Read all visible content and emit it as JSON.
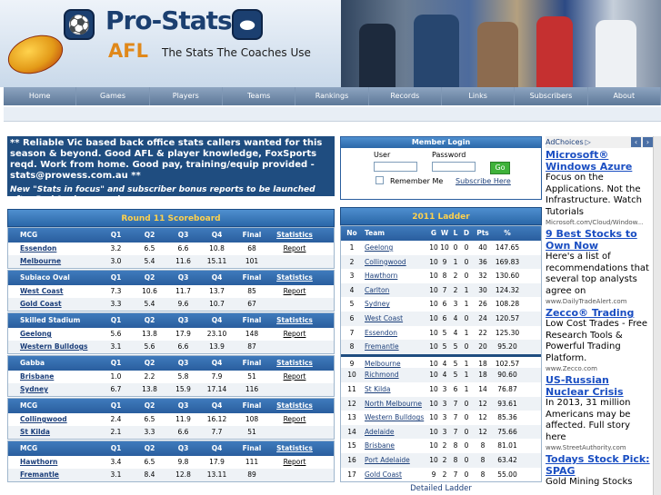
{
  "header": {
    "logo_title": "Pro-Stats",
    "logo_sub": "AFL",
    "tagline": "The Stats The Coaches Use"
  },
  "nav": [
    "Home",
    "Games",
    "Players",
    "Teams",
    "Rankings",
    "Records",
    "Links",
    "Subscribers",
    "About"
  ],
  "news": {
    "main": "** Reliable Vic based back office stats callers wanted for this season & beyond. Good AFL & player knowledge, FoxSports reqd. Work from home. Good pay, training/equip provided - stats@prowess.com.au **",
    "second": "New \"Stats in focus\" and subscriber bonus reports to be launched after Rnd 9, view samples..."
  },
  "scoreboard": {
    "title": "Round 11 Scoreboard",
    "cols": [
      "Q1",
      "Q2",
      "Q3",
      "Q4",
      "Final",
      "Statistics"
    ],
    "games": [
      {
        "venue": "MCG",
        "rows": [
          {
            "team": "Essendon",
            "q": [
              "3.2",
              "6.5",
              "6.6",
              "10.8"
            ],
            "final": "68",
            "link": "Report"
          },
          {
            "team": "Melbourne",
            "q": [
              "3.0",
              "5.4",
              "11.6",
              "15.11"
            ],
            "final": "101",
            "link": ""
          }
        ]
      },
      {
        "venue": "Subiaco Oval",
        "rows": [
          {
            "team": "West Coast",
            "q": [
              "7.3",
              "10.6",
              "11.7",
              "13.7"
            ],
            "final": "85",
            "link": "Report"
          },
          {
            "team": "Gold Coast",
            "q": [
              "3.3",
              "5.4",
              "9.6",
              "10.7"
            ],
            "final": "67",
            "link": ""
          }
        ]
      },
      {
        "venue": "Skilled Stadium",
        "rows": [
          {
            "team": "Geelong",
            "q": [
              "5.6",
              "13.8",
              "17.9",
              "23.10"
            ],
            "final": "148",
            "link": "Report"
          },
          {
            "team": "Western Bulldogs",
            "q": [
              "3.1",
              "5.6",
              "6.6",
              "13.9"
            ],
            "final": "87",
            "link": ""
          }
        ]
      },
      {
        "venue": "Gabba",
        "rows": [
          {
            "team": "Brisbane",
            "q": [
              "1.0",
              "2.2",
              "5.8",
              "7.9"
            ],
            "final": "51",
            "link": "Report"
          },
          {
            "team": "Sydney",
            "q": [
              "6.7",
              "13.8",
              "15.9",
              "17.14"
            ],
            "final": "116",
            "link": ""
          }
        ]
      },
      {
        "venue": "MCG",
        "rows": [
          {
            "team": "Collingwood",
            "q": [
              "2.4",
              "6.5",
              "11.9",
              "16.12"
            ],
            "final": "108",
            "link": "Report"
          },
          {
            "team": "St Kilda",
            "q": [
              "2.1",
              "3.3",
              "6.6",
              "7.7"
            ],
            "final": "51",
            "link": ""
          }
        ]
      },
      {
        "venue": "MCG",
        "rows": [
          {
            "team": "Hawthorn",
            "q": [
              "3.4",
              "6.5",
              "9.8",
              "17.9"
            ],
            "final": "111",
            "link": "Report"
          },
          {
            "team": "Fremantle",
            "q": [
              "3.1",
              "8.4",
              "12.8",
              "13.11"
            ],
            "final": "89",
            "link": ""
          }
        ]
      }
    ]
  },
  "member": {
    "title": "Member Login",
    "user_label": "User",
    "password_label": "Password",
    "go_label": "Go",
    "remember_label": "Remember Me",
    "subscribe_label": "Subscribe Here"
  },
  "ladder": {
    "title": "2011 Ladder",
    "cols": [
      "No",
      "Team",
      "G",
      "W",
      "L",
      "D",
      "Pts",
      "%"
    ],
    "rows": [
      [
        "1",
        "Geelong",
        "10",
        "10",
        "0",
        "0",
        "40",
        "147.65"
      ],
      [
        "2",
        "Collingwood",
        "10",
        "9",
        "1",
        "0",
        "36",
        "169.83"
      ],
      [
        "3",
        "Hawthorn",
        "10",
        "8",
        "2",
        "0",
        "32",
        "130.60"
      ],
      [
        "4",
        "Carlton",
        "10",
        "7",
        "2",
        "1",
        "30",
        "124.32"
      ],
      [
        "5",
        "Sydney",
        "10",
        "6",
        "3",
        "1",
        "26",
        "108.28"
      ],
      [
        "6",
        "West Coast",
        "10",
        "6",
        "4",
        "0",
        "24",
        "120.57"
      ],
      [
        "7",
        "Essendon",
        "10",
        "5",
        "4",
        "1",
        "22",
        "125.30"
      ],
      [
        "8",
        "Fremantle",
        "10",
        "5",
        "5",
        "0",
        "20",
        "95.20"
      ],
      [
        "9",
        "Melbourne",
        "10",
        "4",
        "5",
        "1",
        "18",
        "102.57"
      ],
      [
        "10",
        "Richmond",
        "10",
        "4",
        "5",
        "1",
        "18",
        "90.60"
      ],
      [
        "11",
        "St Kilda",
        "10",
        "3",
        "6",
        "1",
        "14",
        "76.87"
      ],
      [
        "12",
        "North Melbourne",
        "10",
        "3",
        "7",
        "0",
        "12",
        "93.61"
      ],
      [
        "13",
        "Western Bulldogs",
        "10",
        "3",
        "7",
        "0",
        "12",
        "85.36"
      ],
      [
        "14",
        "Adelaide",
        "10",
        "3",
        "7",
        "0",
        "12",
        "75.66"
      ],
      [
        "15",
        "Brisbane",
        "10",
        "2",
        "8",
        "0",
        "8",
        "81.01"
      ],
      [
        "16",
        "Port Adelaide",
        "10",
        "2",
        "8",
        "0",
        "8",
        "63.42"
      ],
      [
        "17",
        "Gold Coast",
        "9",
        "2",
        "7",
        "0",
        "8",
        "55.00"
      ]
    ],
    "detailed_label": "Detailed Ladder"
  },
  "ads": {
    "adchoices": "AdChoices",
    "items": [
      {
        "title": "Microsoft® Windows Azure",
        "body": "Focus on the Applications. Not the Infrastructure. Watch Tutorials",
        "url": "Microsoft.com/Cloud/Window..."
      },
      {
        "title": "9 Best Stocks to Own Now",
        "body": "Here's a list of recommendations that several top analysts agree on",
        "url": "www.DailyTradeAlert.com"
      },
      {
        "title": "Zecco® Trading",
        "body": "Low Cost Trades - Free Research Tools & Powerful Trading Platform.",
        "url": "www.Zecco.com"
      },
      {
        "title": "US-Russian Nuclear Crisis",
        "body": "In 2013, 31 million Americans may be affected. Full story here",
        "url": "www.StreetAuthority.com"
      },
      {
        "title": "Todays Stock Pick: SPAG",
        "body": "Gold Mining Stocks",
        "url": ""
      }
    ]
  }
}
